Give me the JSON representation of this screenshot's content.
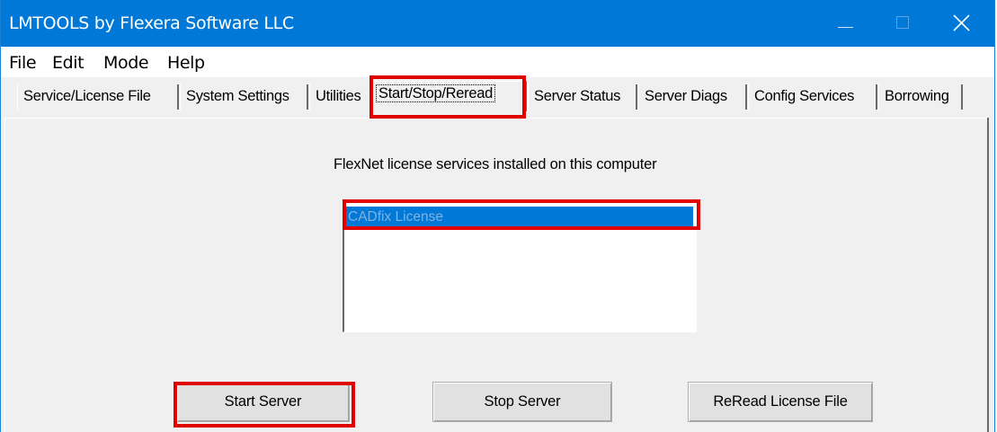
{
  "window": {
    "title": "LMTOOLS by Flexera Software LLC",
    "title_color": "#0078d7"
  },
  "titlebar_buttons": {
    "minimize_icon": "minimize-icon",
    "maximize_icon": "maximize-icon",
    "close_icon": "close-icon"
  },
  "menu": {
    "items": [
      "File",
      "Edit",
      "Mode",
      "Help"
    ]
  },
  "tabs": [
    {
      "label": "Service/License File",
      "active": false
    },
    {
      "label": "System Settings",
      "active": false
    },
    {
      "label": "Utilities",
      "active": false
    },
    {
      "label": "Start/Stop/Reread",
      "active": true
    },
    {
      "label": "Server Status",
      "active": false
    },
    {
      "label": "Server Diags",
      "active": false
    },
    {
      "label": "Config Services",
      "active": false
    },
    {
      "label": "Borrowing",
      "active": false
    }
  ],
  "panel": {
    "caption": "FlexNet license services installed on this computer",
    "services": [
      {
        "label": "CADfix License",
        "selected": true
      }
    ]
  },
  "buttons": {
    "start": "Start Server",
    "stop": "Stop Server",
    "reread": "ReRead License File"
  },
  "highlight_color": "#e10000"
}
